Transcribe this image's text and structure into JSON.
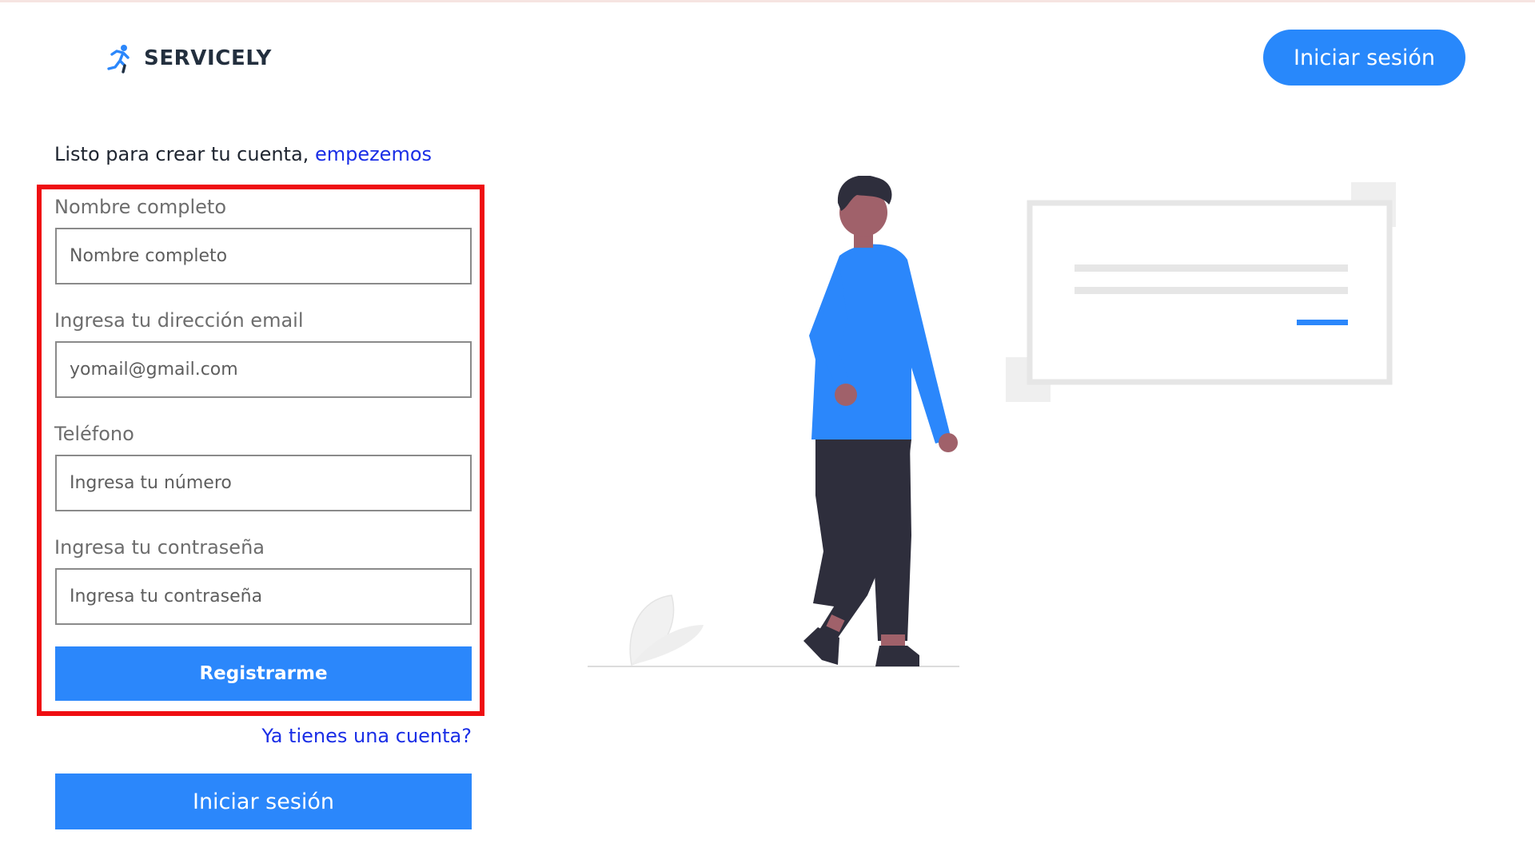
{
  "header": {
    "brand": "SERVICELY",
    "logo_icon": "running-person-icon",
    "login_button": "Iniciar sesión"
  },
  "intro": {
    "text": "Listo para crear tu cuenta,",
    "link": "empezemos"
  },
  "form": {
    "fields": [
      {
        "label": "Nombre completo",
        "placeholder": "Nombre completo",
        "value": ""
      },
      {
        "label": "Ingresa tu dirección email",
        "placeholder": "yomail@gmail.com",
        "value": ""
      },
      {
        "label": "Teléfono",
        "placeholder": "Ingresa tu número",
        "value": ""
      },
      {
        "label": "Ingresa tu contraseña",
        "placeholder": "Ingresa tu contraseña",
        "value": ""
      }
    ],
    "submit": "Registrarme",
    "have_account": "Ya tienes una cuenta?",
    "login": "Iniciar sesión"
  },
  "colors": {
    "primary": "#2b87fb",
    "link": "#1a2ee6",
    "highlight": "#ef0e12",
    "text_dark": "#232f3e",
    "label_gray": "#6d6d6d"
  }
}
